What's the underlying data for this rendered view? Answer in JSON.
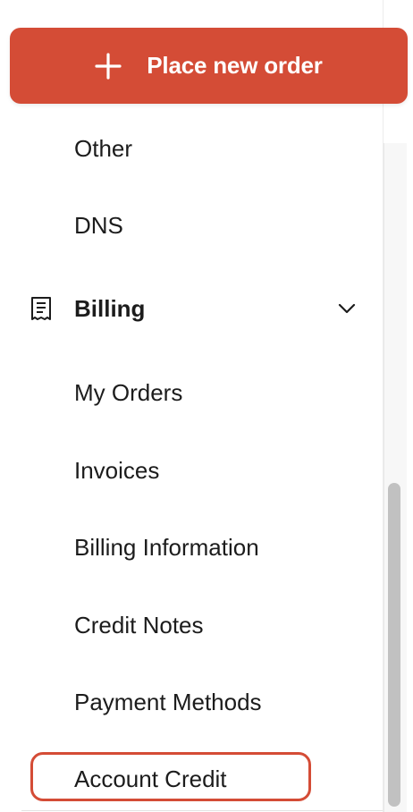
{
  "header": {
    "place_order_label": "Place new order",
    "place_order_icon": "plus-icon",
    "button_color": "#d44c36"
  },
  "nav": {
    "top_items": [
      {
        "label": "Other"
      },
      {
        "label": "DNS"
      }
    ],
    "billing": {
      "title": "Billing",
      "icon": "receipt-icon",
      "expanded": true,
      "items": [
        {
          "label": "My Orders"
        },
        {
          "label": "Invoices"
        },
        {
          "label": "Billing Information"
        },
        {
          "label": "Credit Notes"
        },
        {
          "label": "Payment Methods"
        },
        {
          "label": "Account Credit",
          "active": true
        }
      ]
    }
  },
  "colors": {
    "accent": "#d44c36",
    "text": "#1c1c1c",
    "scrollbar_thumb": "#c1c1c1"
  }
}
